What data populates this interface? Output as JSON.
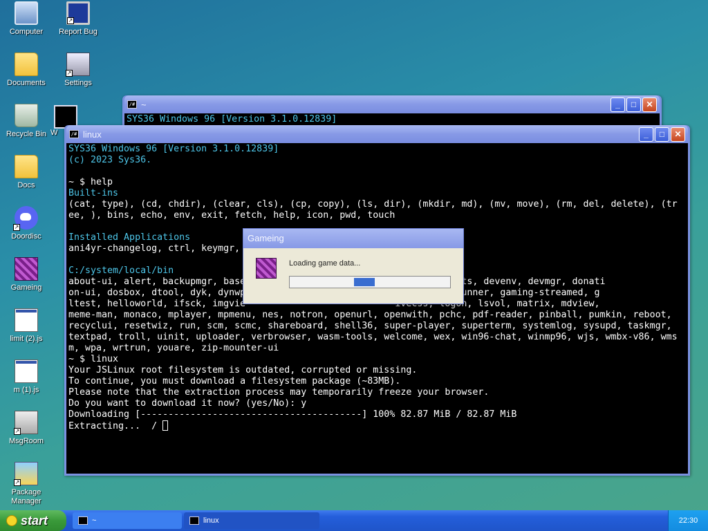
{
  "desktop": {
    "icons": [
      {
        "label": "Computer",
        "icon": "computer-icon"
      },
      {
        "label": "Report Bug",
        "icon": "report-bug-icon"
      },
      {
        "label": "Documents",
        "icon": "documents-folder-icon"
      },
      {
        "label": "Settings",
        "icon": "settings-icon"
      },
      {
        "label": "Recycle Bin",
        "icon": "recycle-bin-icon"
      },
      {
        "label": "Docs",
        "icon": "folder-icon"
      },
      {
        "label": "Doordisc",
        "icon": "discord-icon"
      },
      {
        "label": "Gameing",
        "icon": "gameing-cube-icon"
      },
      {
        "label": "limit (2).js",
        "icon": "js-file-icon"
      },
      {
        "label": "m (1).js",
        "icon": "js-file-icon"
      },
      {
        "label": "MsgRoom",
        "icon": "msgroom-icon"
      },
      {
        "label": "Package Manager",
        "icon": "package-manager-icon"
      },
      {
        "label": "W",
        "icon": "terminal-icon"
      }
    ]
  },
  "windows": {
    "back": {
      "title": "~",
      "lines": [
        "SYS36 Windows 96 [Version 3.1.0.12839]"
      ]
    },
    "front": {
      "title": "linux",
      "lines": [
        {
          "t": "SYS36 Windows 96 [Version 3.1.0.12839]",
          "c": "cyan"
        },
        {
          "t": "(c) 2023 Sys36.",
          "c": "cyan"
        },
        {
          "t": "",
          "c": ""
        },
        {
          "t": "~ $ help",
          "c": ""
        },
        {
          "t": "Built-ins",
          "c": "cyan"
        },
        {
          "t": "(cat, type), (cd, chdir), (clear, cls), (cp, copy), (ls, dir), (mkdir, md), (mv, move), (rm, del, delete), (tr",
          "c": ""
        },
        {
          "t": "ee, ), bins, echo, env, exit, fetch, help, icon, pwd, touch",
          "c": ""
        },
        {
          "t": "",
          "c": ""
        },
        {
          "t": "Installed Applications",
          "c": "cyan"
        },
        {
          "t": "ani4yr-changelog, ctrl, keymgr,",
          "c": ""
        },
        {
          "t": "",
          "c": ""
        },
        {
          "t": "C:/system/local/bin",
          "c": "cyan"
        },
        {
          "t": "about-ui, alert, backupmgr, base                           irror, credits, devenv, devmgr, donati",
          "c": ""
        },
        {
          "t": "on-ui, dosbox, dtool, dyk, dynwp                            g, gaming-runner, gaming-streamed, g",
          "c": ""
        },
        {
          "t": "ltest, helloworld, ifsck, imgvie                           ivecss, logon, lsvol, matrix, mdview,",
          "c": ""
        },
        {
          "t": "meme-man, monaco, mplayer, mpmenu, nes, notron, openurl, openwith, pchc, pdf-reader, pinball, pumkin, reboot,",
          "c": ""
        },
        {
          "t": "recyclui, resetwiz, run, scm, scmc, shareboard, shell36, super-player, superterm, systemlog, sysupd, taskmgr,",
          "c": ""
        },
        {
          "t": "textpad, troll, uinit, uploader, verbrowser, wasm-tools, welcome, wex, win96-chat, winmp96, wjs, wmbx-v86, wms",
          "c": ""
        },
        {
          "t": "m, wpa, wrtrun, youare, zip-mounter-ui",
          "c": ""
        },
        {
          "t": "~ $ linux",
          "c": ""
        },
        {
          "t": "Your JSLinux root filesystem is outdated, corrupted or missing.",
          "c": ""
        },
        {
          "t": "To continue, you must download a filesystem package (~83MB).",
          "c": ""
        },
        {
          "t": "Please note that the extraction process may temporarily freeze your browser.",
          "c": ""
        },
        {
          "t": "Do you want to download it now? (yes/No): y",
          "c": ""
        },
        {
          "t": "Downloading [----------------------------------------] 100% 82.87 MiB / 82.87 MiB",
          "c": ""
        },
        {
          "t": "Extracting...  / ",
          "c": "",
          "cursor": true
        }
      ]
    }
  },
  "dialog": {
    "title": "Gameing",
    "message": "Loading game data...",
    "progress_segment": [
      0.4,
      0.53
    ]
  },
  "taskbar": {
    "start_label": "start",
    "tasks": [
      {
        "label": "~",
        "active": true
      },
      {
        "label": "linux",
        "active": false
      }
    ],
    "clock": "22:30"
  }
}
